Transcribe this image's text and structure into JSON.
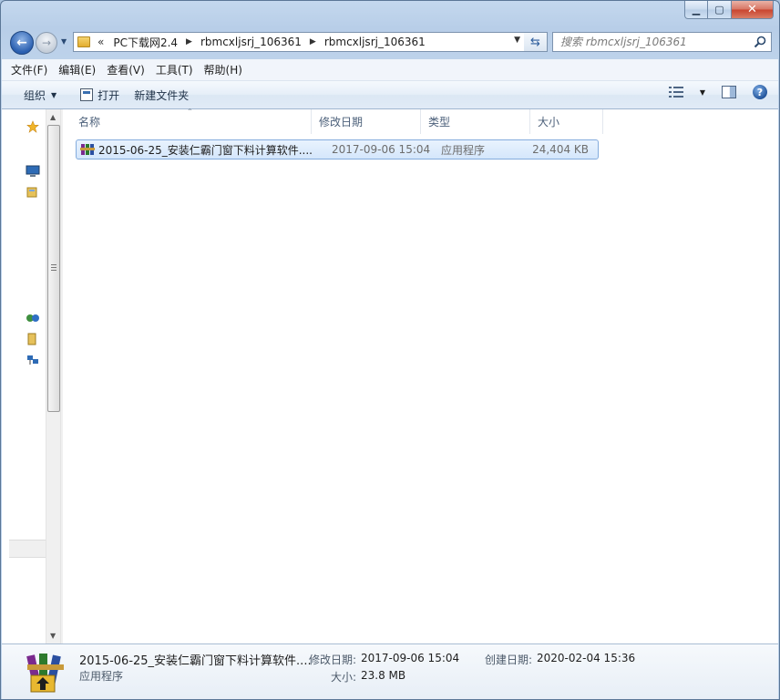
{
  "address": {
    "overflow_chevron": "«",
    "crumbs": [
      "PC下载网2.4",
      "rbmcxljsrj_106361",
      "rbmcxljsrj_106361"
    ]
  },
  "search": {
    "placeholder": "搜索 rbmcxljsrj_106361"
  },
  "menu": {
    "file": "文件(F)",
    "edit": "编辑(E)",
    "view": "查看(V)",
    "tools": "工具(T)",
    "help": "帮助(H)"
  },
  "toolbar": {
    "organize": "组织",
    "open": "打开",
    "new_folder": "新建文件夹"
  },
  "columns": {
    "name": "名称",
    "modified": "修改日期",
    "type": "类型",
    "size": "大小"
  },
  "files": [
    {
      "name": "2015-06-25_安装仁霸门窗下料计算软件....",
      "modified": "2017-09-06 15:04",
      "type": "应用程序",
      "size": "24,404 KB"
    }
  ],
  "details": {
    "name": "2015-06-25_安装仁霸门窗下料计算软件....",
    "type": "应用程序",
    "modified_label": "修改日期:",
    "modified_value": "2017-09-06 15:04",
    "size_label": "大小:",
    "size_value": "23.8 MB",
    "created_label": "创建日期:",
    "created_value": "2020-02-04 15:36"
  },
  "colors": {
    "frame": "#b8cee8",
    "selection": "#d4e6fb",
    "selection_border": "#84acdd",
    "close_button": "#c8432e"
  }
}
